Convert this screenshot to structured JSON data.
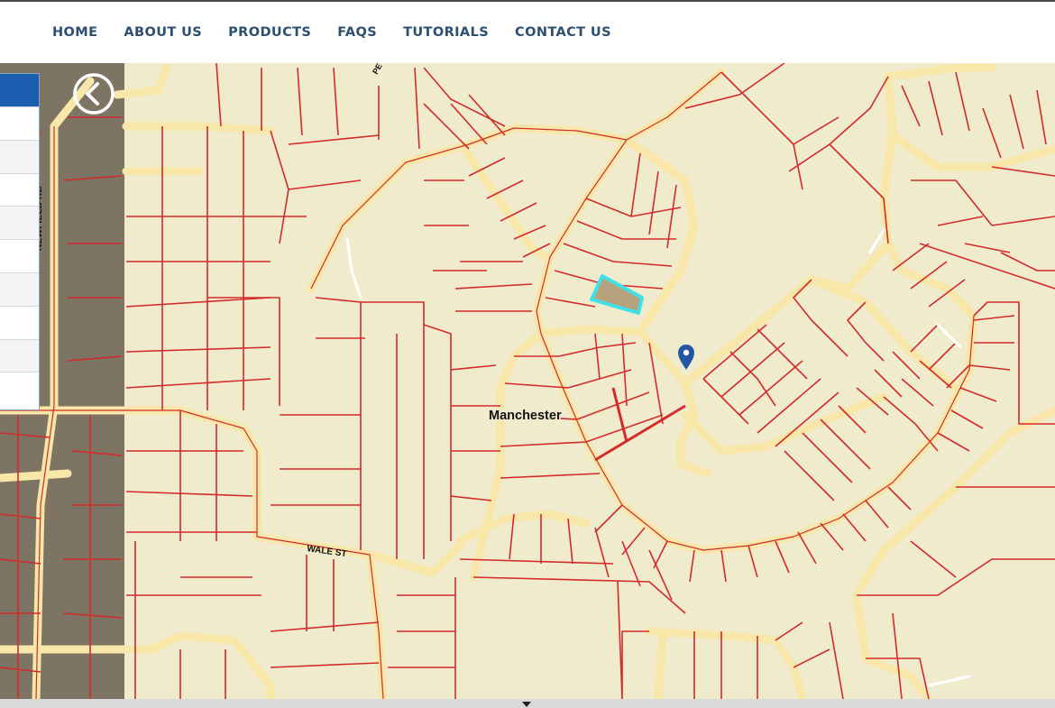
{
  "nav": {
    "items": [
      {
        "label": "HOME"
      },
      {
        "label": "ABOUT US"
      },
      {
        "label": "PRODUCTS"
      },
      {
        "label": "FAQS"
      },
      {
        "label": "TUTORIALS"
      },
      {
        "label": "CONTACT US"
      }
    ]
  },
  "map": {
    "place_label": "Manchester",
    "street_labels": {
      "wale": "WALE ST",
      "newfield": "NEWFIELD RD",
      "top_street": "PE PL NEW"
    },
    "colors": {
      "background": "#f1ebcd",
      "parcel_line": "#d42a2a",
      "road_fill": "#f8e7a8",
      "selected_parcel": "#40e0e8",
      "marker": "#2456a8",
      "sidebar_shade": "#7d7464"
    },
    "icons": {
      "back": "chevron-left-icon",
      "marker": "map-pin-icon",
      "panel_toggle": "caret-down-icon"
    }
  }
}
